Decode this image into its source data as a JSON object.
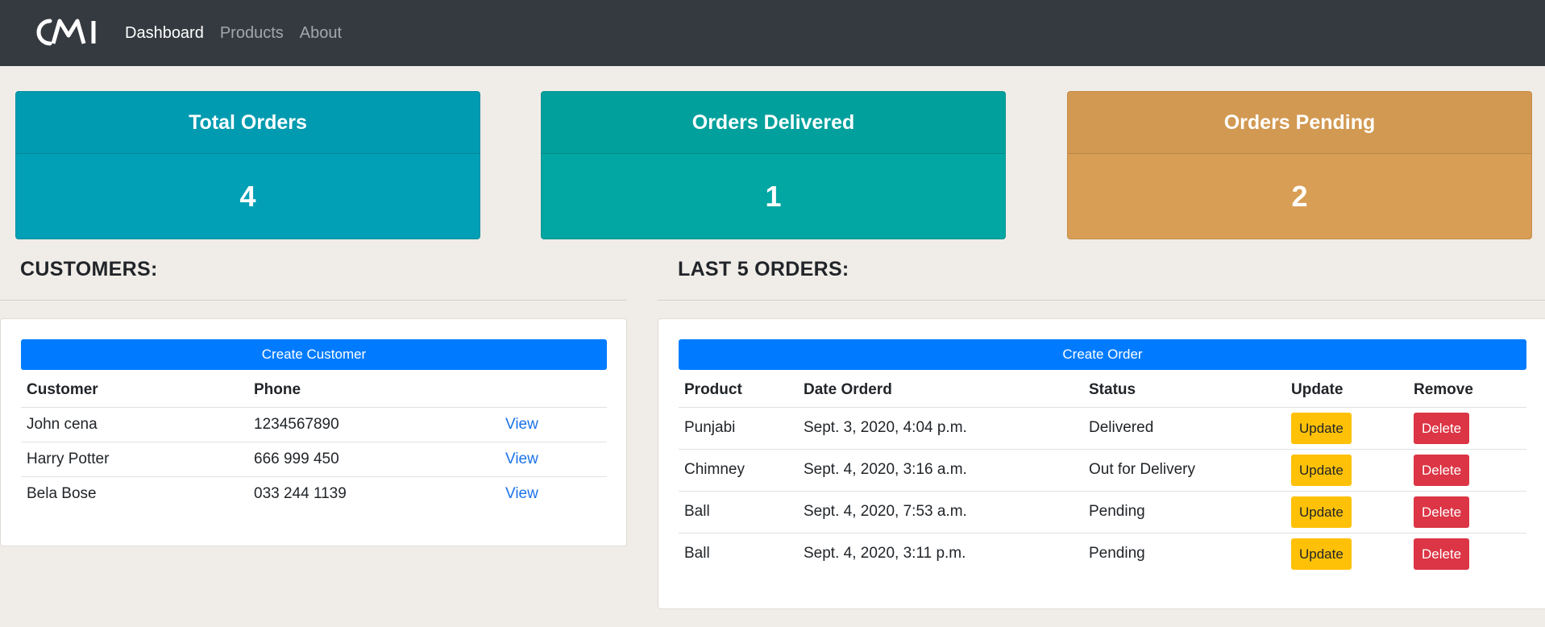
{
  "nav": {
    "links": [
      "Dashboard",
      "Products",
      "About"
    ]
  },
  "stats": {
    "total": {
      "label": "Total Orders",
      "value": "4"
    },
    "delivered": {
      "label": "Orders Delivered",
      "value": "1"
    },
    "pending": {
      "label": "Orders Pending",
      "value": "2"
    }
  },
  "customers": {
    "title": "CUSTOMERS:",
    "create_label": "Create Customer",
    "columns": [
      "Customer",
      "Phone",
      ""
    ],
    "rows": [
      {
        "name": "John cena",
        "phone": "1234567890",
        "action": "View"
      },
      {
        "name": "Harry Potter",
        "phone": "666 999 450",
        "action": "View"
      },
      {
        "name": "Bela Bose",
        "phone": "033 244 1139",
        "action": "View"
      }
    ]
  },
  "orders": {
    "title": "LAST 5 ORDERS:",
    "create_label": "Create Order",
    "columns": [
      "Product",
      "Date Orderd",
      "Status",
      "Update",
      "Remove"
    ],
    "rows": [
      {
        "product": "Punjabi",
        "date": "Sept. 3, 2020, 4:04 p.m.",
        "status": "Delivered",
        "update": "Update",
        "remove": "Delete"
      },
      {
        "product": "Chimney",
        "date": "Sept. 4, 2020, 3:16 a.m.",
        "status": "Out for Delivery",
        "update": "Update",
        "remove": "Delete"
      },
      {
        "product": "Ball",
        "date": "Sept. 4, 2020, 7:53 a.m.",
        "status": "Pending",
        "update": "Update",
        "remove": "Delete"
      },
      {
        "product": "Ball",
        "date": "Sept. 4, 2020, 3:11 p.m.",
        "status": "Pending",
        "update": "Update",
        "remove": "Delete"
      }
    ]
  },
  "colors": {
    "navbar": "#343a40",
    "total_card": "#01a0b6",
    "delivered_card": "#02a6a2",
    "pending_card": "#d99e55",
    "primary": "#007bff",
    "warning": "#ffc107",
    "danger": "#dc3545"
  }
}
